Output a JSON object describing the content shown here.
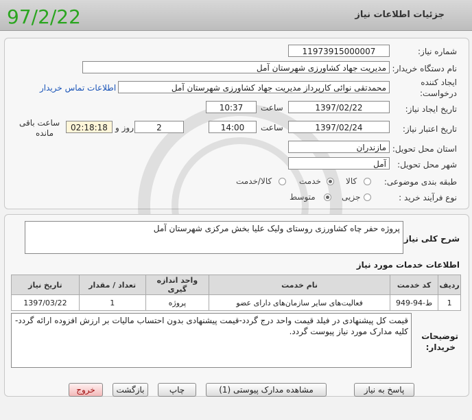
{
  "page": {
    "title": "جزئیات اطلاعات نیاز",
    "watermark_date": "97/2/22"
  },
  "form": {
    "need_number_label": "شماره نیاز:",
    "need_number": "1197391500000­7",
    "buyer_org_label": "نام دستگاه خریدار:",
    "buyer_org": "مدیریت جهاد کشاورزی شهرستان آمل",
    "creator_label_1": "ایجاد کننده",
    "creator_label_2": "درخواست:",
    "creator": "محمدتقی  نوائی  کارپرداز مدیریت جهاد کشاورزی شهرستان آمل",
    "contact_link": "اطلاعات تماس خریدار",
    "created_date_label": "تاریخ ایجاد نیاز:",
    "created_date": "1397/02/22",
    "hour_label": "ساعت",
    "created_time": "10:37",
    "validity_label": "تاریخ اعتبار نیاز:",
    "validity_date": "1397/02/24",
    "validity_time": "14:00",
    "days": "2",
    "days_label": "روز و",
    "remaining": "02:18:18",
    "remaining_label_1": "ساعت باقی",
    "remaining_label_2": "مانده",
    "province_label": "استان محل تحویل:",
    "province": "مازندران",
    "city_label": "شهر محل تحویل:",
    "city": "آمل",
    "category_label": "طبقه بندی موضوعی:",
    "category_options": [
      "کالا",
      "خدمت",
      "کالا/خدمت"
    ],
    "category_selected": "خدمت",
    "process_label": "نوع فرآیند خرید :",
    "process_options": [
      "جزیی",
      "متوسط"
    ],
    "process_selected": "متوسط"
  },
  "description": {
    "label": "شرح کلی نیاز:",
    "text": "پروژه حفر چاه کشاورزی روستای ولیک علیا بخش مرکزی شهرستان آمل"
  },
  "services": {
    "title": "اطلاعات خدمات مورد نیاز",
    "columns": [
      "ردیف",
      "کد خدمت",
      "نام خدمت",
      "واحد اندازه گیری",
      "تعداد / مقدار",
      "تاریخ نیاز"
    ],
    "rows": [
      [
        "1",
        "ط-94-949",
        "فعالیت‌های سایر سازمان‌های دارای عضو",
        "پروژه",
        "1",
        "1397/03/22"
      ]
    ]
  },
  "notes": {
    "label_1": "توضیحات",
    "label_2": "خریدار:",
    "text": "قیمت کل پیشنهادی در فیلد قیمت واحد درج گردد-قیمت پیشنهادی بدون احتساب مالیات بر ارزش افزوده ارائه گردد-کلیه مدارک مورد نیاز پیوست گردد."
  },
  "buttons": {
    "reply": "پاسخ به نیاز",
    "attachments": "مشاهده مدارک پیوستی (1)",
    "print": "چاپ",
    "back": "بازگشت",
    "exit": "خروج"
  }
}
